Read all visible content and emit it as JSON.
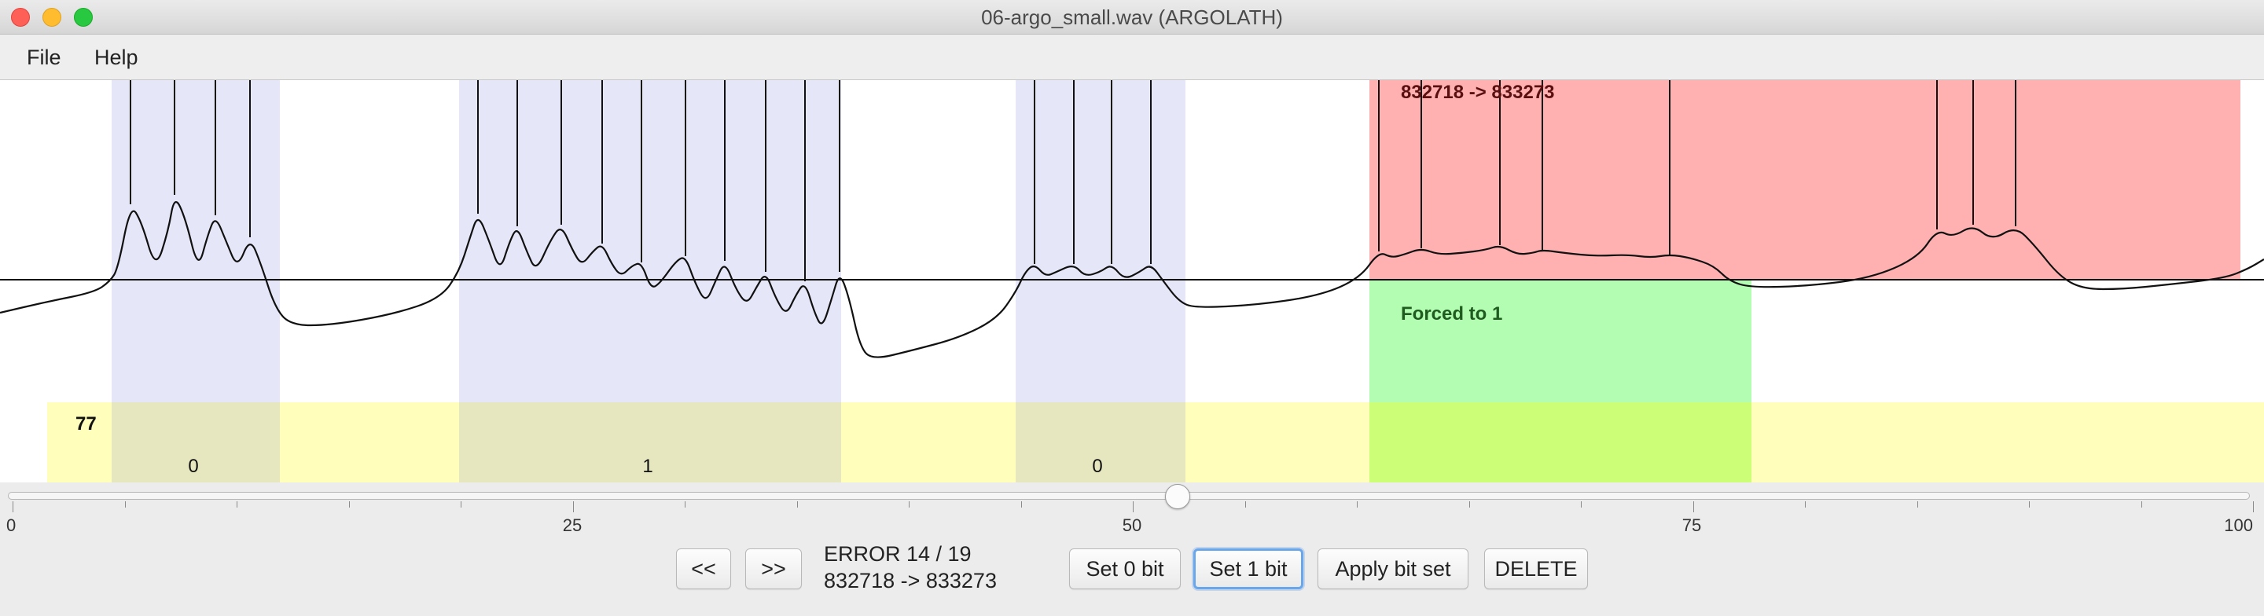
{
  "window": {
    "title": "06-argo_small.wav (ARGOLATH)"
  },
  "menu": {
    "items": [
      "File",
      "Help"
    ]
  },
  "waveform": {
    "range_label": "832718 -> 833273",
    "forced_label": "Forced to 1",
    "group_count": "77",
    "bits": [
      "0",
      "1",
      "0"
    ],
    "colors": {
      "bit_region": "#e5e6f8",
      "error_region": "#ffb1b1",
      "forced_region": "#b2fdb2",
      "data_band": "#ffffbb",
      "bit_band": "#e6e6bf",
      "forced_band": "#ccff77"
    }
  },
  "slider": {
    "value": 52,
    "min": 0,
    "max": 100,
    "tick_labels": [
      "0",
      "25",
      "50",
      "75",
      "100"
    ]
  },
  "controls": {
    "prev_label": "<<",
    "next_label": ">>",
    "status_line1": "ERROR 14 / 19",
    "status_line2": "832718 -> 833273",
    "set0_label": "Set 0 bit",
    "set1_label": "Set 1 bit",
    "apply_label": "Apply bit set",
    "delete_label": "DELETE"
  }
}
